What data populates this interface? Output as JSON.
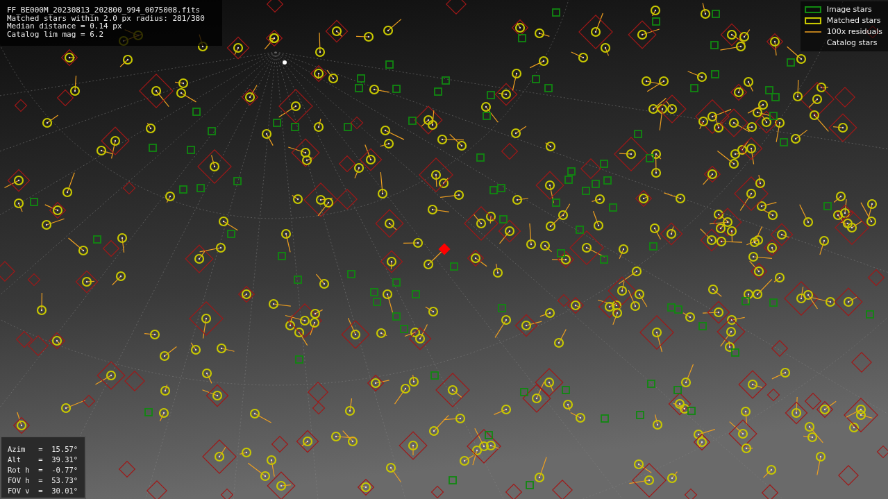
{
  "header": {
    "lines": [
      "FF_BE000M_20230813_202800_994_0075008.fits",
      "Matched stars within 2.0 px radius: 281/380",
      "Median distance = 0.14 px",
      "Catalog lim mag = 6.2"
    ]
  },
  "legend": [
    {
      "kind": "image",
      "label": "Image stars"
    },
    {
      "kind": "matched",
      "label": "Matched stars"
    },
    {
      "kind": "residual",
      "label": "100x residuals"
    },
    {
      "kind": "catalog",
      "label": "Catalog stars"
    }
  ],
  "pointing": {
    "lines": [
      "Azim   =  15.57°",
      "Alt    =  39.31°",
      "Rot h  =  -0.77°",
      "FOV h  =  53.73°",
      "FOV v  =  30.01°"
    ]
  }
}
